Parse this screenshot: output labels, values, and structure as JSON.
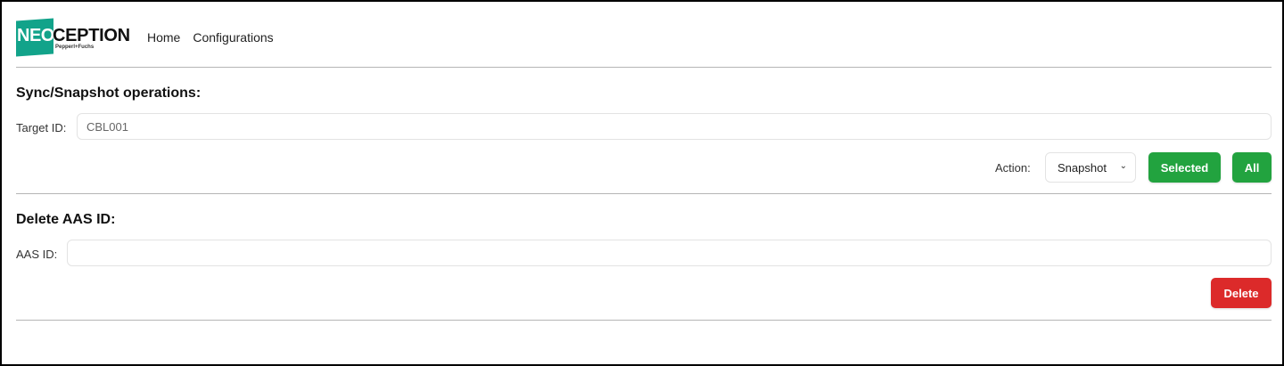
{
  "brand": {
    "logo_block_text": "NEO",
    "logo_main_text": "CEPTION",
    "logo_subtext": "Pepperl+Fuchs",
    "accent_color": "#12a38a"
  },
  "nav": {
    "items": [
      {
        "label": "Home"
      },
      {
        "label": "Configurations"
      }
    ]
  },
  "sync_section": {
    "title": "Sync/Snapshot operations:",
    "target_label": "Target ID:",
    "target_value": "CBL001",
    "action_label": "Action:",
    "action_selected": "Snapshot",
    "selected_button": "Selected",
    "all_button": "All",
    "button_color": "#22a33f"
  },
  "delete_section": {
    "title": "Delete AAS ID:",
    "aas_label": "AAS ID:",
    "aas_value": "",
    "delete_button": "Delete",
    "button_color": "#dc2a2a"
  },
  "icons": {
    "select_chevron": "chevron-down-icon"
  }
}
